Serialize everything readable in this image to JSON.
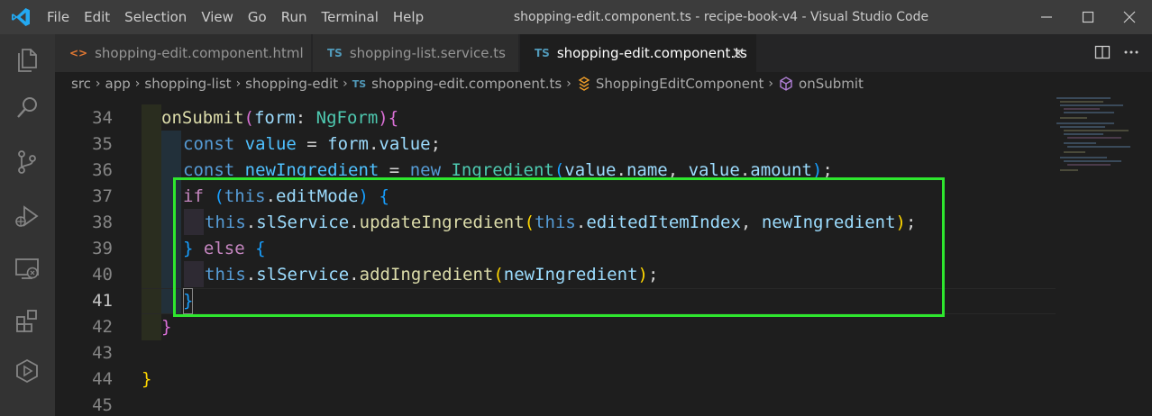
{
  "menu": [
    "File",
    "Edit",
    "Selection",
    "View",
    "Go",
    "Run",
    "Terminal",
    "Help"
  ],
  "window_title": "shopping-edit.component.ts - recipe-book-v4 - Visual Studio Code",
  "tabs": [
    {
      "icon": "<>",
      "label": "shopping-edit.component.html",
      "active": false
    },
    {
      "icon": "TS",
      "label": "shopping-list.service.ts",
      "active": false
    },
    {
      "icon": "TS",
      "label": "shopping-edit.component.ts",
      "active": true
    }
  ],
  "breadcrumb": {
    "items": [
      "src",
      "app",
      "shopping-list",
      "shopping-edit"
    ],
    "file_icon": "TS",
    "file": "shopping-edit.component.ts",
    "class_name": "ShoppingEditComponent",
    "method": "onSubmit"
  },
  "line_numbers": [
    "34",
    "35",
    "36",
    "37",
    "38",
    "39",
    "40",
    "41",
    "42",
    "43",
    "44",
    "45"
  ],
  "code": {
    "l34": {
      "name": "onSubmit",
      "p_open": "(",
      "param": "form",
      "colon": ": ",
      "type": "NgForm",
      "p_close": ")",
      "brace": "{"
    },
    "l35": {
      "kw": "const ",
      "name": "value",
      "eq": " = ",
      "obj": "form",
      "dot": ".",
      "prop": "value",
      "semi": ";"
    },
    "l36": {
      "kw1": "const ",
      "name": "newIngredient",
      "eq": " = ",
      "kw2": "new ",
      "cls": "Ingredient",
      "p_open": "(",
      "a1": "value",
      "d1": ".",
      "p1": "name",
      "comma": ", ",
      "a2": "value",
      "d2": ".",
      "p2": "amount",
      "p_close": ")",
      "semi": ";"
    },
    "l37": {
      "kw": "if",
      "sp": " ",
      "p_open": "(",
      "this": "this",
      "dot": ".",
      "prop": "editMode",
      "p_close": ")",
      "sp2": " ",
      "brace": "{"
    },
    "l38": {
      "this": "this",
      "d1": ".",
      "obj": "slService",
      "d2": ".",
      "fn": "updateIngredient",
      "p_open": "(",
      "this2": "this",
      "d3": ".",
      "a1": "editedItemIndex",
      "comma": ", ",
      "a2": "newIngredient",
      "p_close": ")",
      "semi": ";"
    },
    "l39": {
      "brace_close": "}",
      "sp": " ",
      "kw": "else",
      "sp2": " ",
      "brace_open": "{"
    },
    "l40": {
      "this": "this",
      "d1": ".",
      "obj": "slService",
      "d2": ".",
      "fn": "addIngredient",
      "p_open": "(",
      "a1": "newIngredient",
      "p_close": ")",
      "semi": ";"
    },
    "l41": {
      "brace": "}"
    },
    "l42": {
      "brace": "}"
    },
    "l44": {
      "brace": "}"
    }
  },
  "colors": {
    "highlight_box": "#2ee62e",
    "accent": "#007acc"
  }
}
